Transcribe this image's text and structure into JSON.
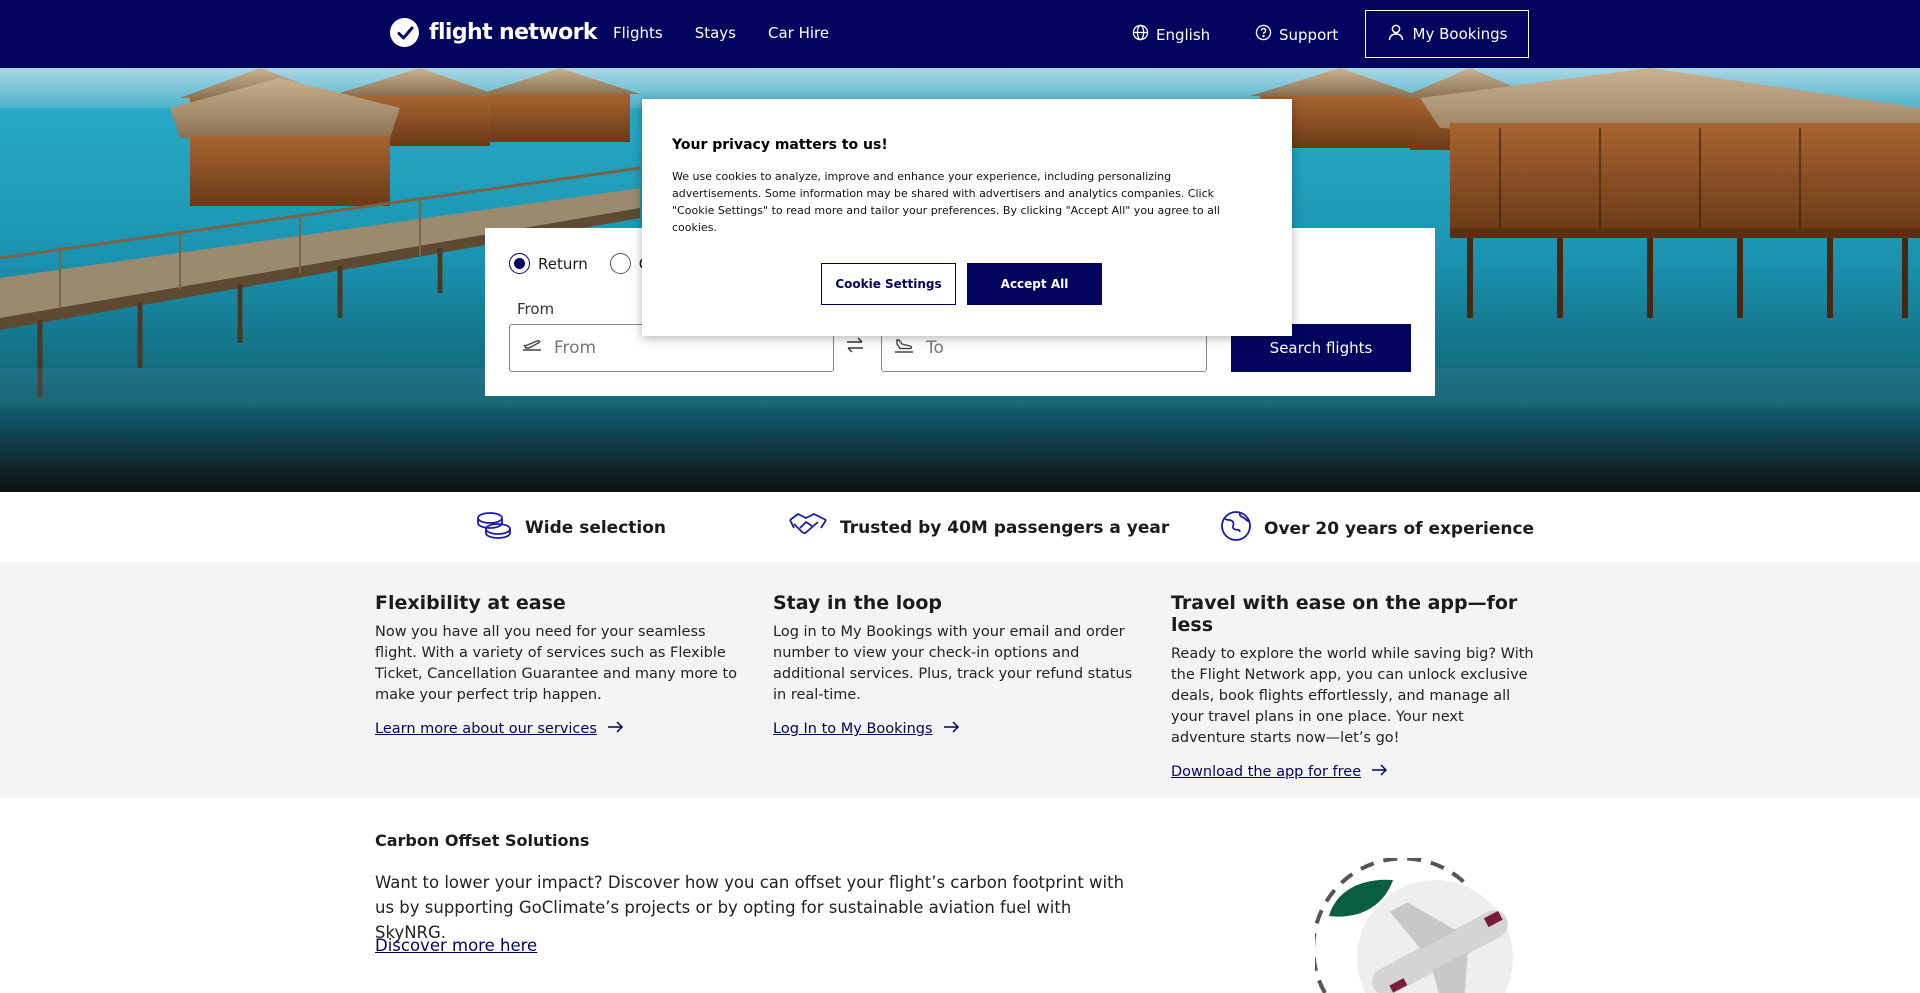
{
  "header": {
    "brand": "flight network",
    "nav": [
      "Flights",
      "Stays",
      "Car Hire"
    ],
    "language": "English",
    "support": "Support",
    "bookings": "My Bookings"
  },
  "search": {
    "trip_types": [
      "Return",
      "O"
    ],
    "selected_trip_type": "Return",
    "from_label": "From",
    "from_placeholder": "From",
    "to_placeholder": "To",
    "search_button": "Search flights"
  },
  "cookie": {
    "title": "Your privacy matters to us!",
    "text": "We use cookies to analyze, improve and enhance your experience, including personalizing advertisements. Some information may be shared with advertisers and analytics companies. Click \"Cookie Settings\" to read more and tailor your preferences. By clicking \"Accept All\" you agree to all cookies.",
    "settings_button": "Cookie Settings",
    "accept_button": "Accept All"
  },
  "usps": [
    {
      "icon": "coins-icon",
      "label": "Wide selection"
    },
    {
      "icon": "handshake-icon",
      "label": "Trusted by 40M passengers a year"
    },
    {
      "icon": "globe-icon",
      "label": "Over 20 years of experience"
    }
  ],
  "info": [
    {
      "title": "Flexibility at ease",
      "text": "Now you have all you need for your seamless flight. With a variety of services such as Flexible Ticket, Cancellation Guarantee and many more to make your perfect trip happen.",
      "link": "Learn more about our services"
    },
    {
      "title": "Stay in the loop",
      "text": "Log in to My Bookings with your email and order number to view your check-in options and additional services. Plus, track your refund status in real-time.",
      "link": "Log In to My Bookings"
    },
    {
      "title": "Travel with ease on the app—for less",
      "text": "Ready to explore the world while saving big? With the Flight Network app, you can unlock exclusive deals, book flights effortlessly, and manage all your travel plans in one place. Your next adventure starts now—let’s go!",
      "link": "Download the app for free"
    }
  ],
  "carbon": {
    "title": "Carbon Offset Solutions",
    "text": "Want to lower your impact? Discover how you can offset your flight’s carbon footprint with us by supporting GoClimate’s projects or by opting for sustainable aviation fuel with SkyNRG.",
    "link": "Discover more here"
  },
  "colors": {
    "brand_navy": "#02045e",
    "leaf_green": "#0b5e3f",
    "accent_maroon": "#7a1a3c"
  }
}
